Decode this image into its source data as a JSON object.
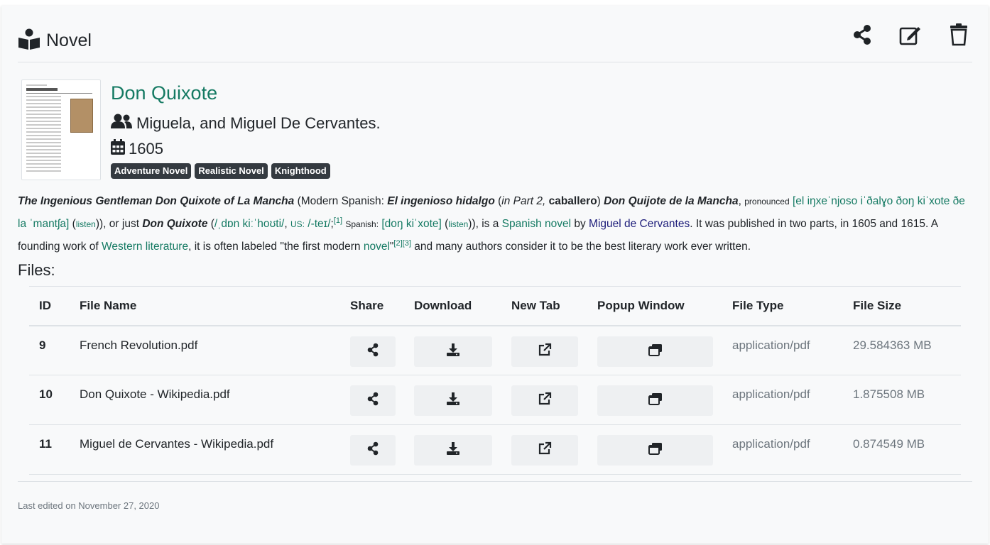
{
  "header": {
    "title": "Novel",
    "icon": "book-reader-icon"
  },
  "book": {
    "title": "Don Quixote",
    "authors": "Miguela, and Miguel De Cervantes.",
    "year": "1605",
    "tags": [
      "Adventure Novel",
      "Realistic Novel",
      "Knighthood"
    ]
  },
  "description": {
    "t1": "The Ingenious Gentleman Don Quixote of La Mancha",
    "t2": " (Modern Spanish: ",
    "t3": "El ingenioso hidalgo",
    "t4": " (",
    "t5": "in Part 2,",
    "t6": " caballero",
    "t7": ") ",
    "t8": "Don Quijote de la Mancha",
    "t9": ", ",
    "t10": "pronounced",
    "t11": " ",
    "t12": "[el iŋxeˈnjoso iˈðalɣo ðoŋ kiˈxote ðe la ˈmantʃa]",
    "t13": " (",
    "t14": "listen",
    "t15": ")), or just ",
    "t16": "Don Quixote",
    "t17": " (",
    "t18": "/ˌdɒn kiːˈhoʊti/",
    "t19": ", ",
    "t20": "US:",
    "t21": " ",
    "t22": "/-teɪ/",
    "t23": ";",
    "t24": "[1]",
    "t25": " ",
    "t26": "Spanish:",
    "t27": " ",
    "t28": "[doŋ kiˈxote]",
    "t29": " (",
    "t30": "listen",
    "t31": ")), is a ",
    "t32": "Spanish novel",
    "t33": " by ",
    "t34": "Miguel de Cervantes",
    "t35": ". It was published in two parts, in 1605 and 1615. A founding work of ",
    "t36": "Western literature",
    "t37": ", it is often labeled \"the first modern ",
    "t38": "novel",
    "t39": "\"",
    "t40": "[2][3]",
    "t41": " and many authors consider it to be the best literary work ever written."
  },
  "files": {
    "heading": "Files:",
    "columns": [
      "ID",
      "File Name",
      "Share",
      "Download",
      "New Tab",
      "Popup Window",
      "File Type",
      "File Size"
    ],
    "rows": [
      {
        "id": "9",
        "name": "French Revolution.pdf",
        "type": "application/pdf",
        "size": "29.584363 MB"
      },
      {
        "id": "10",
        "name": "Don Quixote - Wikipedia.pdf",
        "type": "application/pdf",
        "size": "1.875508 MB"
      },
      {
        "id": "11",
        "name": "Miguel de Cervantes - Wikipedia.pdf",
        "type": "application/pdf",
        "size": "0.874549 MB"
      }
    ]
  },
  "footer": {
    "text": "Last edited on November 27, 2020"
  },
  "colors": {
    "link": "#157a63",
    "badge": "#343a40"
  }
}
